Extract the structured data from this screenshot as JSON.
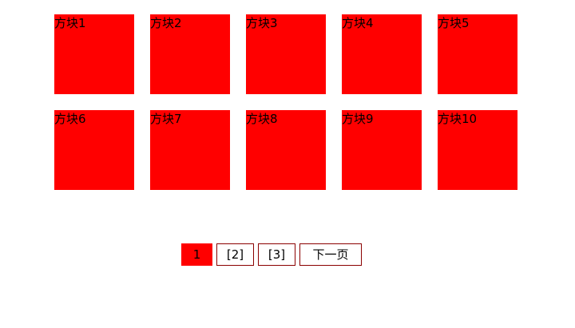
{
  "tiles": [
    {
      "label": "方块1"
    },
    {
      "label": "方块2"
    },
    {
      "label": "方块3"
    },
    {
      "label": "方块4"
    },
    {
      "label": "方块5"
    },
    {
      "label": "方块6"
    },
    {
      "label": "方块7"
    },
    {
      "label": "方块8"
    },
    {
      "label": "方块9"
    },
    {
      "label": "方块10"
    }
  ],
  "pagination": {
    "current": "1",
    "pages": [
      "[2]",
      "[3]"
    ],
    "next_label": "下一页"
  },
  "colors": {
    "tile": "#ff0000",
    "current_page": "#ff0000",
    "pager_border": "#8b0000"
  }
}
